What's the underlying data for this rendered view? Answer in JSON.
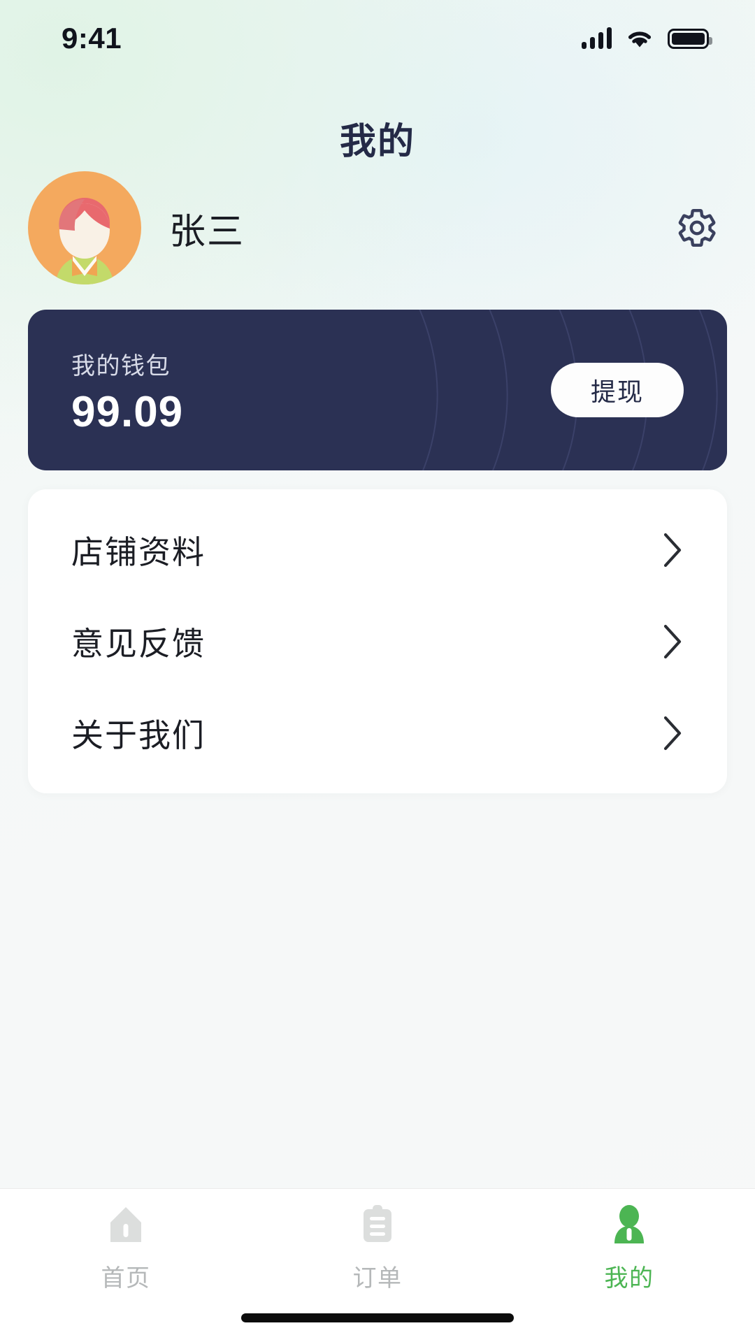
{
  "status_bar": {
    "time": "9:41",
    "signal_icon": "signal-bars-icon",
    "wifi_icon": "wifi-icon",
    "battery_icon": "battery-full-icon"
  },
  "header": {
    "title": "我的"
  },
  "profile": {
    "avatar_icon": "user-avatar-illustration",
    "name": "张三",
    "settings_icon": "gear-icon"
  },
  "wallet": {
    "label": "我的钱包",
    "amount": "99.09",
    "withdraw_label": "提现"
  },
  "menu": {
    "items": [
      {
        "label": "店铺资料",
        "chevron_icon": "chevron-right-icon"
      },
      {
        "label": "意见反馈",
        "chevron_icon": "chevron-right-icon"
      },
      {
        "label": "关于我们",
        "chevron_icon": "chevron-right-icon"
      }
    ]
  },
  "tabbar": {
    "items": [
      {
        "label": "首页",
        "icon": "home-icon",
        "active": false
      },
      {
        "label": "订单",
        "icon": "clipboard-order-icon",
        "active": false
      },
      {
        "label": "我的",
        "icon": "person-profile-icon",
        "active": true
      }
    ]
  },
  "colors": {
    "accent_green": "#4cb553",
    "card_navy": "#2b3154",
    "text_primary": "#1b1d24",
    "text_muted": "#b5b8b9",
    "avatar_orange": "#f4a95e",
    "avatar_hair": "#e8696e",
    "avatar_shirt": "#c3da6a"
  }
}
